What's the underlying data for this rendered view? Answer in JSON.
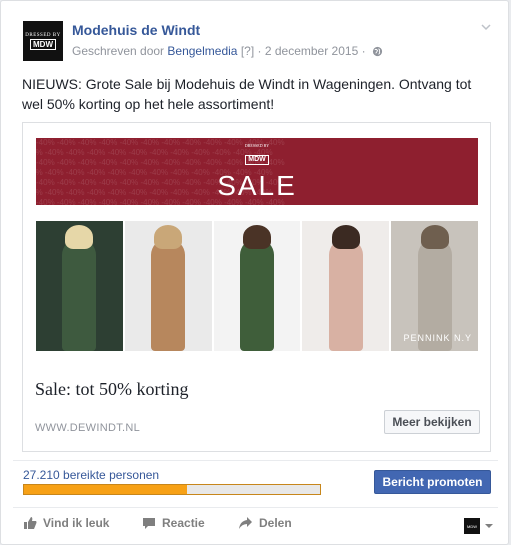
{
  "post": {
    "page_name": "Modehuis de Windt",
    "meta_prefix": "Geschreven door",
    "author": "Bengelmedia",
    "author_note": "[?]",
    "separator": "·",
    "date": "2 december 2015",
    "text": "NIEUWS: Grote Sale bij Modehuis de Windt in Wageningen. Ontvang tot wel 50% korting op het hele assortiment!",
    "avatar_line1": "DRESSED BY",
    "avatar_line2": "MDW"
  },
  "attachment": {
    "banner_small": "DRESSED BY",
    "banner_logo": "MDW",
    "banner_text": "SALE",
    "banner_pattern": "-40% -40% -40% -40% -40% -40% -40% -40% -40% -40% -40% -40%",
    "watermark": "PENNINK N.Y",
    "title": "Sale: tot 50% korting",
    "domain": "WWW.DEWINDT.NL",
    "cta_label": "Meer bekijken"
  },
  "insights": {
    "reach_label": "27.210 bereikte personen",
    "reach_fraction": 0.55,
    "promote_label": "Bericht promoten"
  },
  "actions": {
    "like": "Vind ik leuk",
    "comment": "Reactie",
    "share": "Delen"
  },
  "colors": {
    "link": "#365899",
    "banner": "#8e1f2f",
    "reach_fill": "#f7a116",
    "promote": "#4267b2"
  },
  "icons": [
    "chevron-down-icon",
    "globe-icon",
    "like-icon",
    "comment-icon",
    "share-icon",
    "caret-down-icon"
  ]
}
